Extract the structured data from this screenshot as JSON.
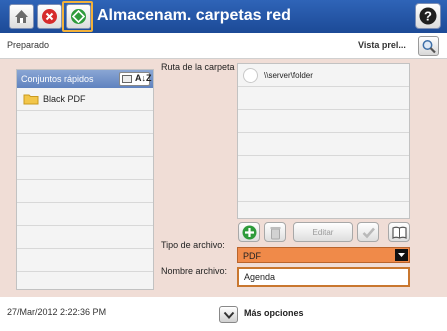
{
  "header": {
    "title": "Almacenam. carpetas red",
    "buttons": {
      "home": "home-icon",
      "stop": "stop-icon",
      "start": "start-icon",
      "help": "help-icon"
    }
  },
  "status": {
    "text": "Preparado",
    "preview_label": "Vista prel..."
  },
  "quick_sets": {
    "header_label": "Conjuntos rápidos",
    "sort_label": "A↓Z",
    "items": [
      {
        "label": "Black PDF"
      },
      {
        "label": ""
      },
      {
        "label": ""
      },
      {
        "label": ""
      },
      {
        "label": ""
      },
      {
        "label": ""
      },
      {
        "label": ""
      },
      {
        "label": ""
      },
      {
        "label": ""
      }
    ]
  },
  "folder_paths": {
    "label": "Ruta de la carpeta",
    "items": [
      {
        "path": "\\\\server\\folder"
      },
      {
        "path": ""
      },
      {
        "path": ""
      },
      {
        "path": ""
      },
      {
        "path": ""
      },
      {
        "path": ""
      },
      {
        "path": ""
      }
    ],
    "edit_label": "Editar"
  },
  "file_type": {
    "label": "Tipo de archivo:",
    "value": "PDF"
  },
  "file_name": {
    "label": "Nombre archivo:",
    "value": "Agenda"
  },
  "footer": {
    "datetime": "27/Mar/2012 2:22:36 PM",
    "more_options": "Más opciones"
  },
  "colors": {
    "title_bar": "#2f64b8",
    "panel_bg": "#f0ddd6",
    "select_accent": "#f08a49",
    "focus_border": "#c9772f",
    "start_highlight": "#f2b13a"
  }
}
